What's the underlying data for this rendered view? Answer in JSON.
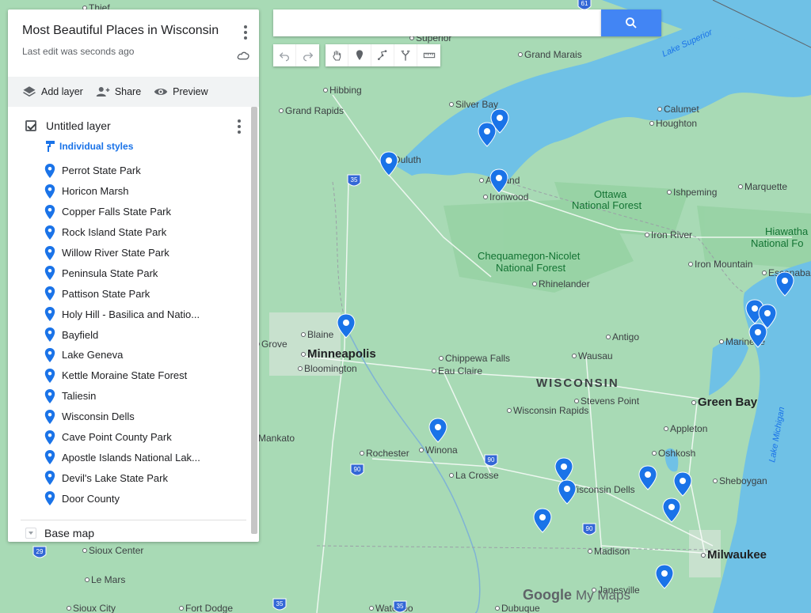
{
  "panel": {
    "title": "Most Beautiful Places in Wisconsin",
    "subtitle": "Last edit was seconds ago",
    "toolbar": {
      "add_layer": "Add layer",
      "share": "Share",
      "preview": "Preview"
    },
    "layer": {
      "name": "Untitled layer",
      "styles": "Individual styles",
      "places": [
        "Perrot State Park",
        "Horicon Marsh",
        "Copper Falls State Park",
        "Rock Island State Park",
        "Willow River State Park",
        "Peninsula State Park",
        "Pattison State Park",
        "Holy Hill - Basilica and Natio...",
        "Bayfield",
        "Lake Geneva",
        "Kettle Moraine State Forest",
        "Taliesin",
        "Wisconsin Dells",
        "Cave Point County Park",
        "Apostle Islands National Lak...",
        "Devil's Lake State Park",
        "Door County"
      ]
    },
    "base_map": "Base map"
  },
  "search": {
    "value": ""
  },
  "attribution": {
    "google": "Google",
    "mymaps": "My Maps"
  },
  "map": {
    "cities": [
      {
        "name": "Minneapolis",
        "big": true
      },
      {
        "name": "Blaine"
      },
      {
        "name": "Bloomington"
      },
      {
        "name": "Grove"
      },
      {
        "name": "Duluth"
      },
      {
        "name": "Hibbing"
      },
      {
        "name": "Grand Rapids"
      },
      {
        "name": "Silver Bay"
      },
      {
        "name": "Grand Marais"
      },
      {
        "name": "Superior"
      },
      {
        "name": "Ashland"
      },
      {
        "name": "Ironwood"
      },
      {
        "name": "Calumet"
      },
      {
        "name": "Houghton"
      },
      {
        "name": "Ishpeming"
      },
      {
        "name": "Marquette"
      },
      {
        "name": "Iron River"
      },
      {
        "name": "Iron Mountain"
      },
      {
        "name": "Escanaba"
      },
      {
        "name": "Rhinelander"
      },
      {
        "name": "Antigo"
      },
      {
        "name": "Wausau"
      },
      {
        "name": "Chippewa Falls"
      },
      {
        "name": "Eau Claire"
      },
      {
        "name": "Stevens Point"
      },
      {
        "name": "Wisconsin Rapids"
      },
      {
        "name": "Green Bay",
        "big": true
      },
      {
        "name": "Appleton"
      },
      {
        "name": "Oshkosh"
      },
      {
        "name": "Sheboygan"
      },
      {
        "name": "Marinette"
      },
      {
        "name": "Rochester"
      },
      {
        "name": "Winona"
      },
      {
        "name": "La Crosse"
      },
      {
        "name": "Wisconsin Dells"
      },
      {
        "name": "Madison"
      },
      {
        "name": "Milwaukee",
        "big": true
      },
      {
        "name": "Janesville"
      },
      {
        "name": "Dubuque"
      },
      {
        "name": "Waterloo"
      },
      {
        "name": "Sioux Center"
      },
      {
        "name": "Le Mars"
      },
      {
        "name": "Sioux City"
      },
      {
        "name": "Fort Dodge"
      },
      {
        "name": "Mankato"
      },
      {
        "name": "Thief"
      }
    ],
    "state_label": "WISCONSIN",
    "parks": [
      "Ottawa National Forest",
      "Chequamegon-Nicolet National Forest",
      "Hiawatha National Fo"
    ],
    "water": [
      "Lake Superior",
      "Lake Michigan"
    ],
    "highways": [
      "35",
      "35",
      "90",
      "90",
      "90",
      "29",
      "35",
      "61"
    ]
  },
  "colors": {
    "land": "#a8dab5",
    "water": "#6fc1e6",
    "pin": "#1a73e8",
    "accent": "#4285f4"
  }
}
